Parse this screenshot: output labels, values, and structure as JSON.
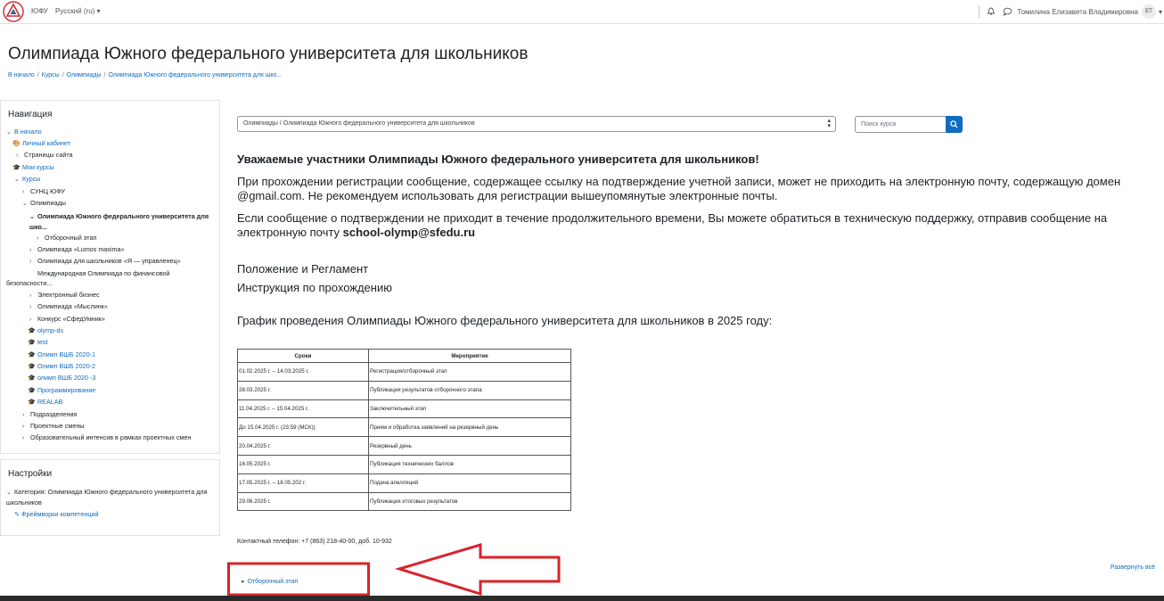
{
  "topbar": {
    "site_name": "ЮФУ",
    "language": "Русский (ru)",
    "user_name": "Томилина Елизавета Владимировна",
    "user_initials": "ЕТ"
  },
  "header": {
    "title": "Олимпиада Южного федерального университета для школьников",
    "breadcrumb": [
      "В начало",
      "Курсы",
      "Олимпиады",
      "Олимпиада Южного федерального университета для шко..."
    ]
  },
  "navigation": {
    "title": "Навигация",
    "items": [
      {
        "label": "В начало"
      },
      {
        "label": "Личный кабинет"
      },
      {
        "label": "Страницы сайта"
      },
      {
        "label": "Мои курсы"
      },
      {
        "label": "Курсы"
      },
      {
        "label": "СУНЦ ЮФУ"
      },
      {
        "label": "Олимпиады"
      },
      {
        "label": "Олимпиада Южного федерального университета для шко..."
      },
      {
        "label": "Отборочный этап"
      },
      {
        "label": "Олимпиада «Lumos maxima»"
      },
      {
        "label": "Олимпиада для школьников «Я — управленец»"
      },
      {
        "label": "Международная Олимпиада по финансовой безопасности..."
      },
      {
        "label": "Электронный бизнес"
      },
      {
        "label": "Олимпиада «Мыслинк»"
      },
      {
        "label": "Конкурс «СфедУмник»"
      },
      {
        "label": "olymp-ds"
      },
      {
        "label": "test"
      },
      {
        "label": "Олимп ВШБ 2020-1"
      },
      {
        "label": "Олимп ВШБ 2020-2"
      },
      {
        "label": "олимп ВШБ 2020 -3"
      },
      {
        "label": "Программирование"
      },
      {
        "label": "REALAB"
      },
      {
        "label": "Подразделения"
      },
      {
        "label": "Проектные смены"
      },
      {
        "label": "Образовательный интенсив в рамках проектных смен"
      }
    ]
  },
  "settings": {
    "title": "Настройки",
    "items": [
      {
        "label": "Категория: Олимпиада Южного федерального университета для школьников"
      },
      {
        "label": "Фреймворки компетенций"
      }
    ]
  },
  "course_select": {
    "value": "Олимпиады / Олимпиада Южного федерального университета для школьников"
  },
  "search": {
    "placeholder": "Поиск курса"
  },
  "content": {
    "heading": "Уважаемые участники Олимпиады Южного федерального университета для школьников!",
    "para1": "При прохождении регистрации сообщение, содержащее ссылку на подтверждение учетной записи, может не приходить на электронную почту, содержащую домен @gmail.com. Не рекомендуем использовать для регистрации вышеупомянутые электронные почты.",
    "para2_text": "Если сообщение о подтверждении не приходит в течение продолжительного времени, Вы можете обратиться в техническую поддержку, отправив сообщение на электронную почту ",
    "para2_email": "school-olymp@sfedu.ru",
    "link1": "Положение и Регламент",
    "link2": "Инструкция по прохождению",
    "schedule_title": "График проведения Олимпиады Южного федерального университета для школьников в 2025 году:",
    "contact": "Контактный телефон: +7 (863) 218-40-00, доб. 10-932",
    "expand_all": "Развернуть всё",
    "section": "Отборочный этап"
  },
  "schedule": {
    "headers": [
      "Сроки",
      "Мероприятие"
    ],
    "rows": [
      [
        "01.02.2025 г. – 14.03.2025 г.",
        "Регистрация/отборочный этап"
      ],
      [
        "28.03.2025 г.",
        "Публикация результатов отборочного этапа"
      ],
      [
        "11.04.2025 г. – 15.04.2025 г.",
        "Заключительный этап"
      ],
      [
        "До 15.04.2025 г. (23:59 (МСК))",
        "Прием и обработка заявлений на резервный день"
      ],
      [
        "20.04.2025 г.",
        "Резервный день"
      ],
      [
        "16.05.2025 г.",
        "Публикация технических баллов"
      ],
      [
        "17.05.2025 г. – 18.05.202 г.",
        "Подача апелляций"
      ],
      [
        "29.06.2025 г.",
        "Публикация итоговых результатов"
      ]
    ]
  },
  "colors": {
    "link": "#0f6cbf",
    "annotation": "#d9232a"
  }
}
